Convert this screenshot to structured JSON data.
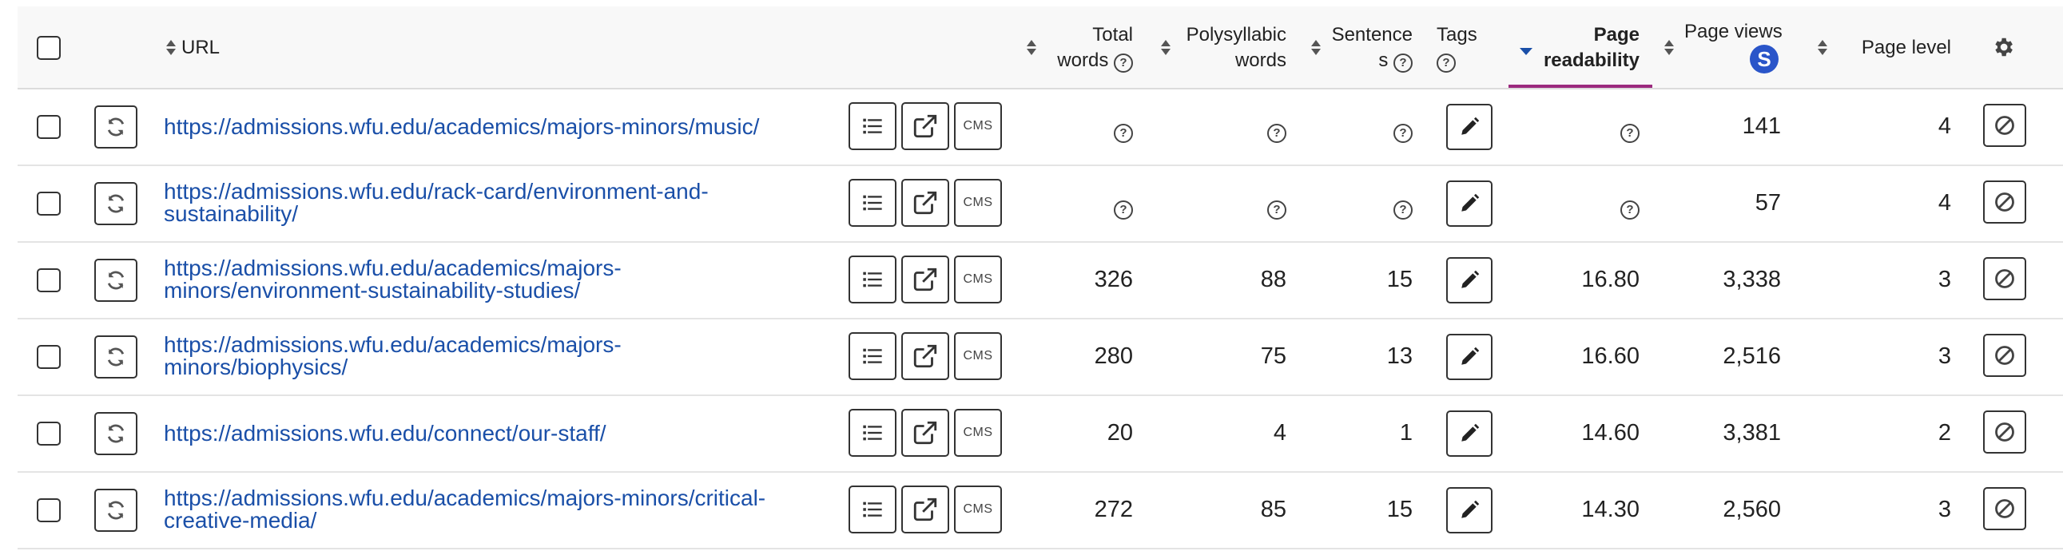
{
  "header": {
    "url_label": "URL",
    "total_words_line1": "Total",
    "total_words_line2": "words",
    "polysyllabic_line1": "Polysyllabic",
    "polysyllabic_line2": "words",
    "sentences_line1": "Sentence",
    "sentences_line2": "s",
    "tags_label": "Tags",
    "readability_line1": "Page",
    "readability_line2": "readability",
    "page_views_label": "Page views",
    "page_views_badge": "S",
    "page_level_label": "Page level",
    "help_glyph": "?"
  },
  "row_buttons": {
    "cms_label": "CMS"
  },
  "rows": [
    {
      "url_line1": "https://admissions.wfu.edu/academics/majors-minors/music/",
      "url_line2": "",
      "total_words": "",
      "polysyllabic_words": "",
      "sentences": "",
      "page_readability": "",
      "page_views": "141",
      "page_level": "4",
      "help": "?"
    },
    {
      "url_line1": "https://admissions.wfu.edu/rack-card/environment-and-",
      "url_line2": "sustainability/",
      "total_words": "",
      "polysyllabic_words": "",
      "sentences": "",
      "page_readability": "",
      "page_views": "57",
      "page_level": "4",
      "help": "?"
    },
    {
      "url_line1": "https://admissions.wfu.edu/academics/majors-",
      "url_line2": "minors/environment-sustainability-studies/",
      "total_words": "326",
      "polysyllabic_words": "88",
      "sentences": "15",
      "page_readability": "16.80",
      "page_views": "3,338",
      "page_level": "3",
      "help": "?"
    },
    {
      "url_line1": "https://admissions.wfu.edu/academics/majors-",
      "url_line2": "minors/biophysics/",
      "total_words": "280",
      "polysyllabic_words": "75",
      "sentences": "13",
      "page_readability": "16.60",
      "page_views": "2,516",
      "page_level": "3",
      "help": "?"
    },
    {
      "url_line1": "https://admissions.wfu.edu/connect/our-staff/",
      "url_line2": "",
      "total_words": "20",
      "polysyllabic_words": "4",
      "sentences": "1",
      "page_readability": "14.60",
      "page_views": "3,381",
      "page_level": "2",
      "help": "?"
    },
    {
      "url_line1": "https://admissions.wfu.edu/academics/majors-minors/critical-",
      "url_line2": "creative-media/",
      "total_words": "272",
      "polysyllabic_words": "85",
      "sentences": "15",
      "page_readability": "14.30",
      "page_views": "2,560",
      "page_level": "3",
      "help": "?"
    }
  ],
  "icons": {
    "select_all": "checkbox-icon",
    "refresh": "refresh-icon",
    "list": "list-icon",
    "external": "external-link-icon",
    "edit": "pencil-icon",
    "exclude": "exclude-icon",
    "settings": "gear-icon",
    "help": "help-circle-icon",
    "sort": "sort-arrows-icon",
    "sorted_desc": "sort-desc-icon"
  },
  "colors": {
    "link": "#1a4fa8",
    "active_sort_underline": "#9b2a7e",
    "badge": "#2a55c9"
  }
}
